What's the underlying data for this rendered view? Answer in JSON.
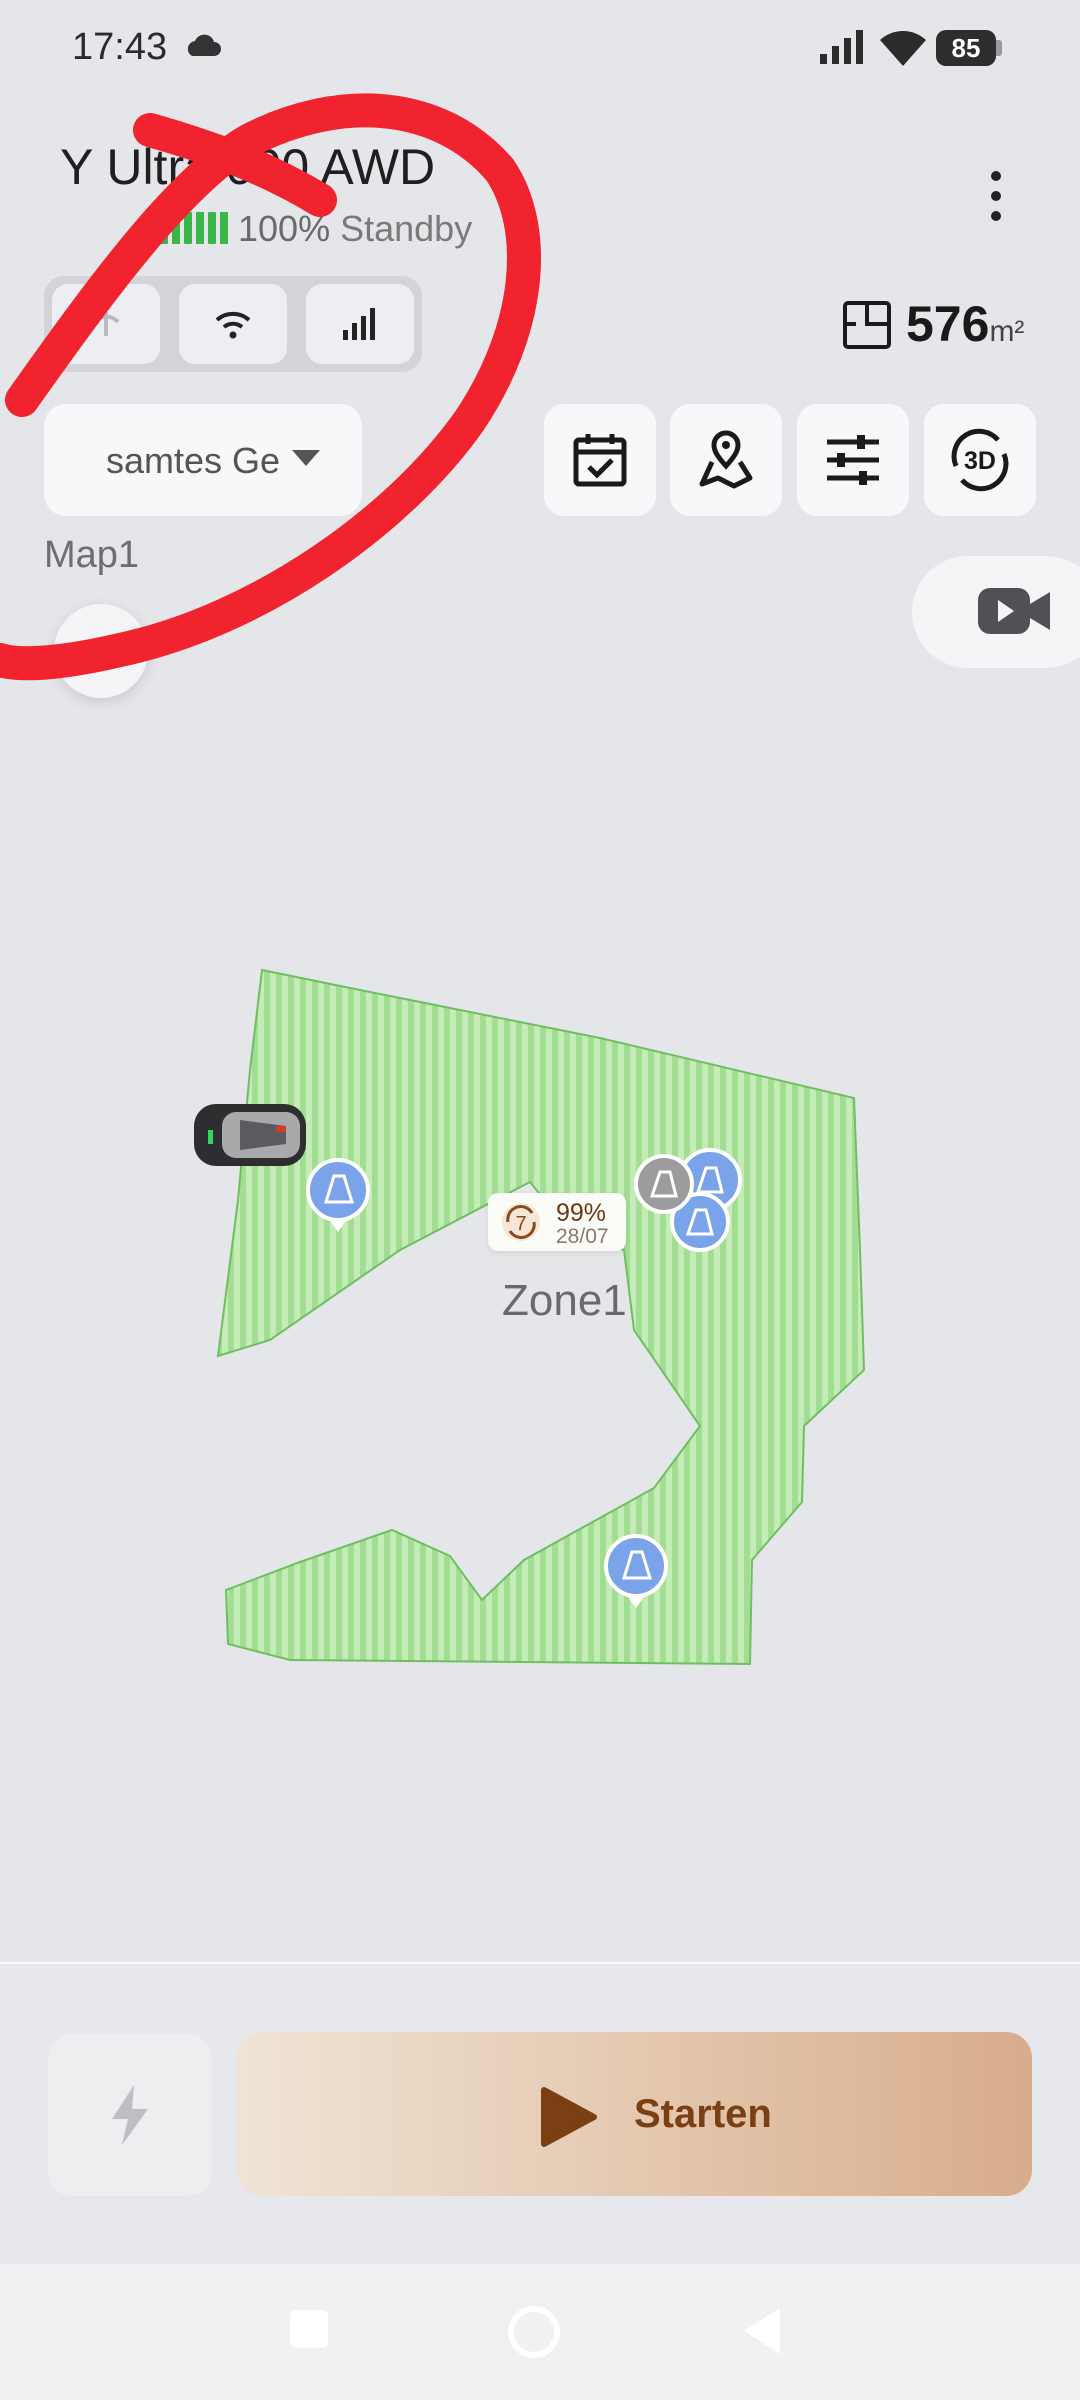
{
  "status_bar": {
    "time": "17:43",
    "battery": "85",
    "icons": [
      "cloud-icon",
      "signal-icon",
      "wifi-icon",
      "battery-icon"
    ]
  },
  "header": {
    "device_name": "Y Ultra 000 AWD",
    "battery_percent": "100%",
    "status": "Standby",
    "battery_level": 1.0,
    "connectivity_icons": [
      "bluetooth-icon",
      "wifi-icon",
      "cellular-icon"
    ],
    "area_value": "576",
    "area_unit": "m²"
  },
  "toolbar": {
    "map_selector_text": "samtes Ge",
    "map_name": "Map1",
    "buttons": [
      "schedule-icon",
      "map-pin-icon",
      "settings-sliders-icon",
      "3d-view-icon"
    ]
  },
  "map": {
    "zone_name": "Zone1",
    "progress_percent": "99%",
    "progress_date": "28/07"
  },
  "bottom": {
    "start_label": "Starten"
  },
  "colors": {
    "lawn_green": "#b6e6a8",
    "lawn_stripe": "#9fdb8f",
    "accent_brown": "#7a3f13",
    "annotation_red": "#f0232f",
    "marker_blue": "#7ba3ea"
  }
}
